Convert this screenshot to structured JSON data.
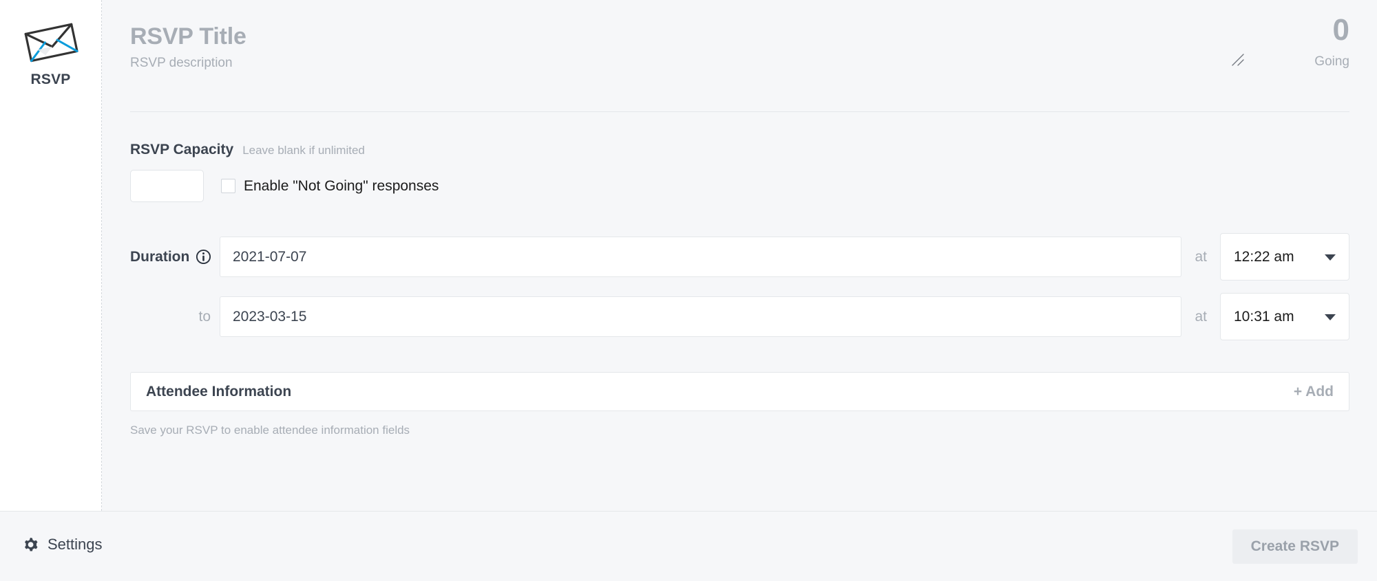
{
  "sidebar": {
    "icon": "envelope-icon",
    "label": "RSVP"
  },
  "header": {
    "title": "RSVP Title",
    "description": "RSVP description",
    "resize_handle": "resize-handle-icon",
    "going_count": "0",
    "going_label": "Going"
  },
  "capacity": {
    "label": "RSVP Capacity",
    "hint": "Leave blank if unlimited",
    "input_value": "",
    "input_placeholder": "",
    "checkbox_label": "Enable \"Not Going\" responses",
    "checkbox_checked": false
  },
  "duration": {
    "label": "Duration",
    "info_icon": "info-icon",
    "to_label": "to",
    "at_label_start": "at",
    "at_label_end": "at",
    "start_date": "2021-07-07",
    "start_date_placeholder": "",
    "start_time": "12:22 am",
    "end_date": "2023-03-15",
    "end_date_placeholder": "",
    "end_time": "10:31 am",
    "caret_icon": "chevron-down-icon"
  },
  "attendee": {
    "title": "Attendee Information",
    "add_label": "+ Add",
    "note": "Save your RSVP to enable attendee information fields"
  },
  "footer": {
    "settings_icon": "gear-icon",
    "settings_label": "Settings",
    "create_label": "Create RSVP"
  },
  "colors": {
    "page_background": "#f6f7f9",
    "panel_background": "#ffffff",
    "text_primary": "#3c4450",
    "text_muted": "#a7adb5",
    "border": "#e4e7ea",
    "accent_blue": "#0a9cdb",
    "button_disabled": "#eceef1"
  }
}
